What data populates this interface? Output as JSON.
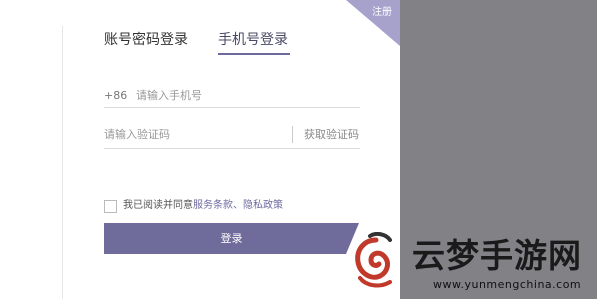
{
  "tabs": {
    "password_login": "账号密码登录",
    "sms_login": "手机号登录"
  },
  "register_label": "注册",
  "phone": {
    "country_code": "+86",
    "placeholder": "请输入手机号"
  },
  "code": {
    "placeholder": "请输入验证码",
    "get_code_label": "获取验证码"
  },
  "agreement": {
    "prefix": "我已阅读并同意",
    "terms_link": "服务条款",
    "separator": "、",
    "privacy_link": "隐私政策"
  },
  "login_button": "登录",
  "watermark": {
    "title": "云梦手游网",
    "url": "www.yunmengchina.com"
  },
  "colors": {
    "accent": "#6f6b9b",
    "overlay": "#818186",
    "corner": "#a6a2cc"
  }
}
